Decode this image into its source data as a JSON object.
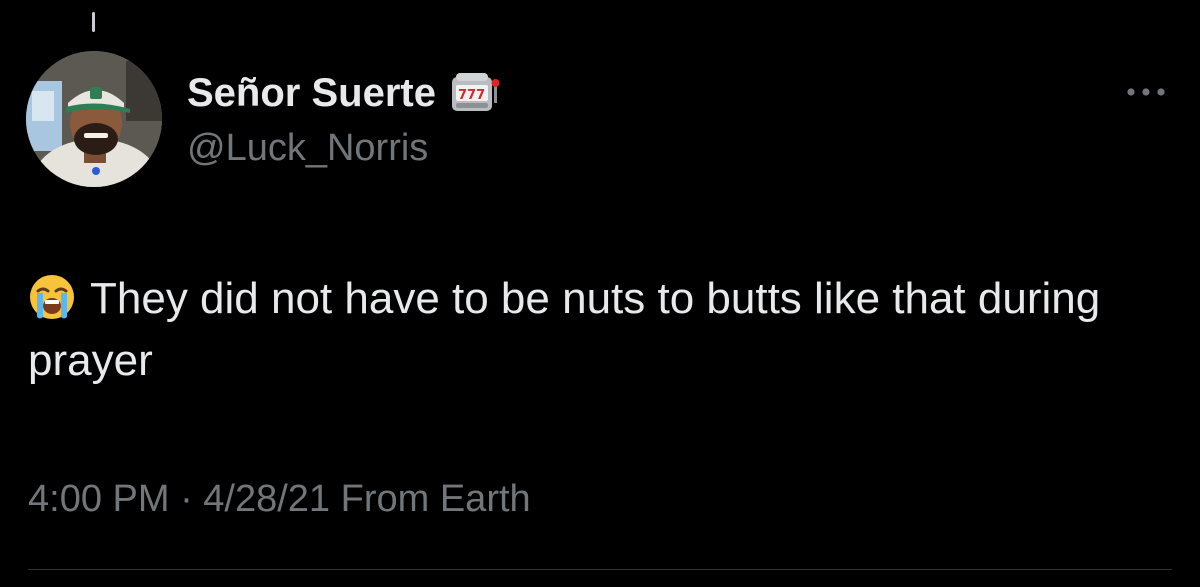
{
  "tweet": {
    "author": {
      "display_name": "Señor Suerte",
      "name_emoji": "slot-machine-icon",
      "handle": "@Luck_Norris"
    },
    "body": {
      "leading_emoji": "loudly-crying-face-icon",
      "text": "They did not have to be nuts to butts like that during prayer"
    },
    "meta": {
      "timestamp": "4:00 PM · 4/28/21 From Earth"
    },
    "more_icon": "more-options-icon"
  },
  "theme": {
    "background": "#000000",
    "primary_text": "#e7e9ea",
    "secondary_text": "#71767b",
    "divider": "#2f3336"
  }
}
